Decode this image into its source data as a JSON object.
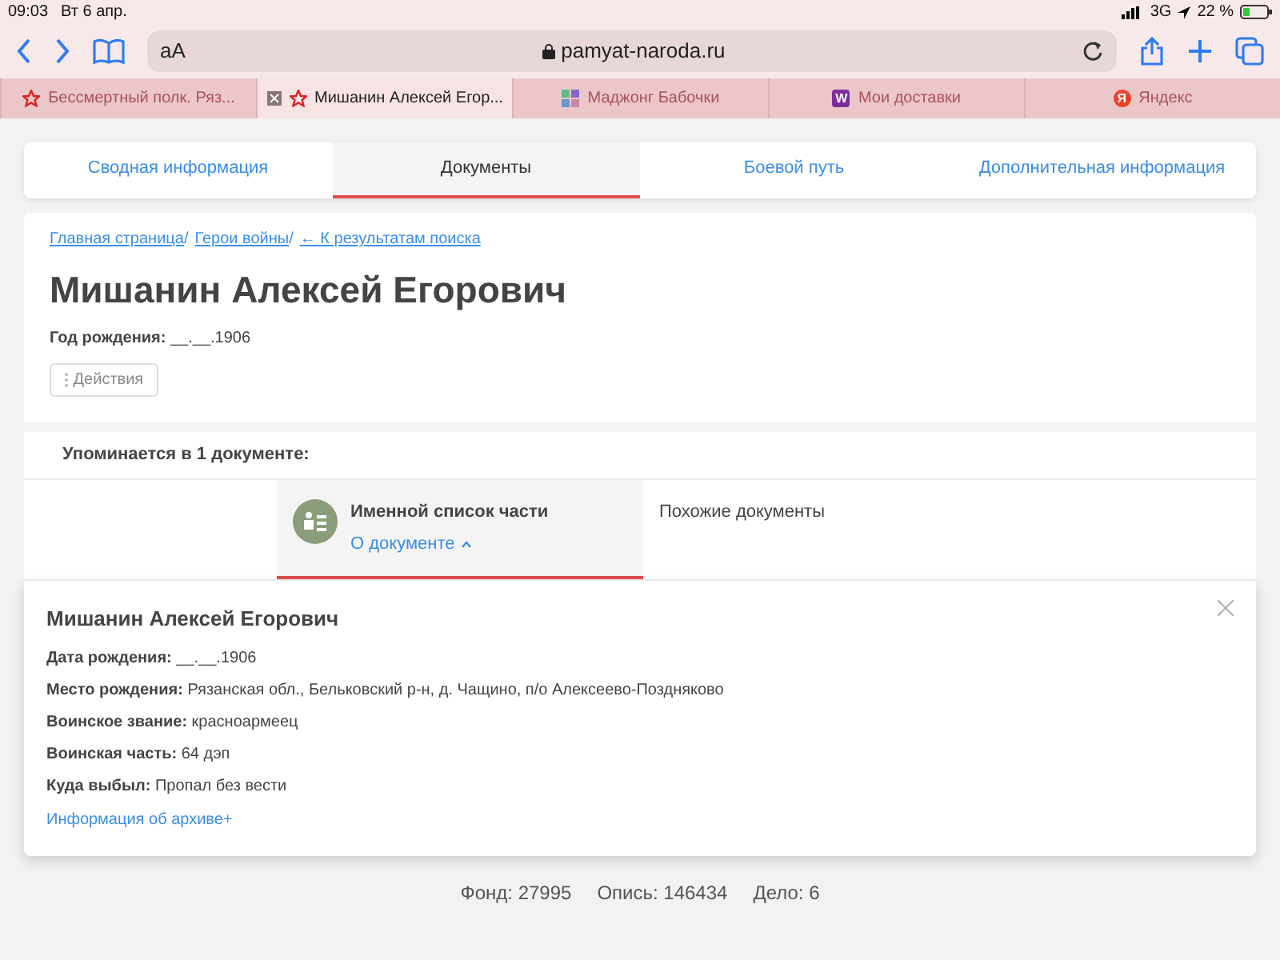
{
  "status_bar": {
    "time": "09:03",
    "date": "Вт 6 апр.",
    "network": "3G",
    "battery": "22 %"
  },
  "toolbar": {
    "text_size": "aA",
    "address": "pamyat-naroda.ru"
  },
  "browser_tabs": [
    {
      "title": "Бессмертный полк. Ряз...",
      "kind": "star",
      "selected": false
    },
    {
      "title": "Мишанин Алексей Егор...",
      "kind": "star",
      "selected": true
    },
    {
      "title": "Маджонг Бабочки",
      "kind": "grid",
      "selected": false
    },
    {
      "title": "Мои доставки",
      "kind": "letter",
      "letter": "W",
      "color": "#7b2d9b",
      "selected": false
    },
    {
      "title": "Яндекс",
      "kind": "letter",
      "letter": "Я",
      "color": "#e8442c",
      "selected": false
    }
  ],
  "page_tabs": [
    {
      "label": "Сводная информация",
      "selected": false
    },
    {
      "label": "Документы",
      "selected": true
    },
    {
      "label": "Боевой путь",
      "selected": false
    },
    {
      "label": "Дополнительная информация",
      "selected": false
    }
  ],
  "breadcrumbs": [
    {
      "label": "Главная страница",
      "separator": "/"
    },
    {
      "label": "Герои войны",
      "separator": "/"
    },
    {
      "label": "← К результатам поиска"
    }
  ],
  "person": {
    "name": "Мишанин Алексей Егорович",
    "birth_label": "Год рождения:",
    "birth_value": "__.__.1906"
  },
  "actions_button": "Действия",
  "mentions": "Упоминается в 1 документе:",
  "doc_tabs": [
    {
      "title": "Именной список части",
      "link": "О документе",
      "selected": true
    },
    {
      "title": "Похожие документы",
      "selected": false
    }
  ],
  "popup": {
    "title": "Мишанин Алексей Егорович",
    "fields": [
      {
        "label": "Дата рождения:",
        "value": "__.__.1906"
      },
      {
        "label": "Место рождения:",
        "value": "Рязанская обл., Бельковский р-н, д. Чащино, п/о Алексеево-Поздняково"
      },
      {
        "label": "Воинское звание:",
        "value": "красноармеец"
      },
      {
        "label": "Воинская часть:",
        "value": "64 дэп"
      },
      {
        "label": "Куда выбыл:",
        "value": "Пропал без вести"
      }
    ],
    "archive_link": "Информация об архиве+"
  },
  "archive_refs": [
    "Фонд: 27995",
    "Опись: 146434",
    "Дело: 6"
  ]
}
